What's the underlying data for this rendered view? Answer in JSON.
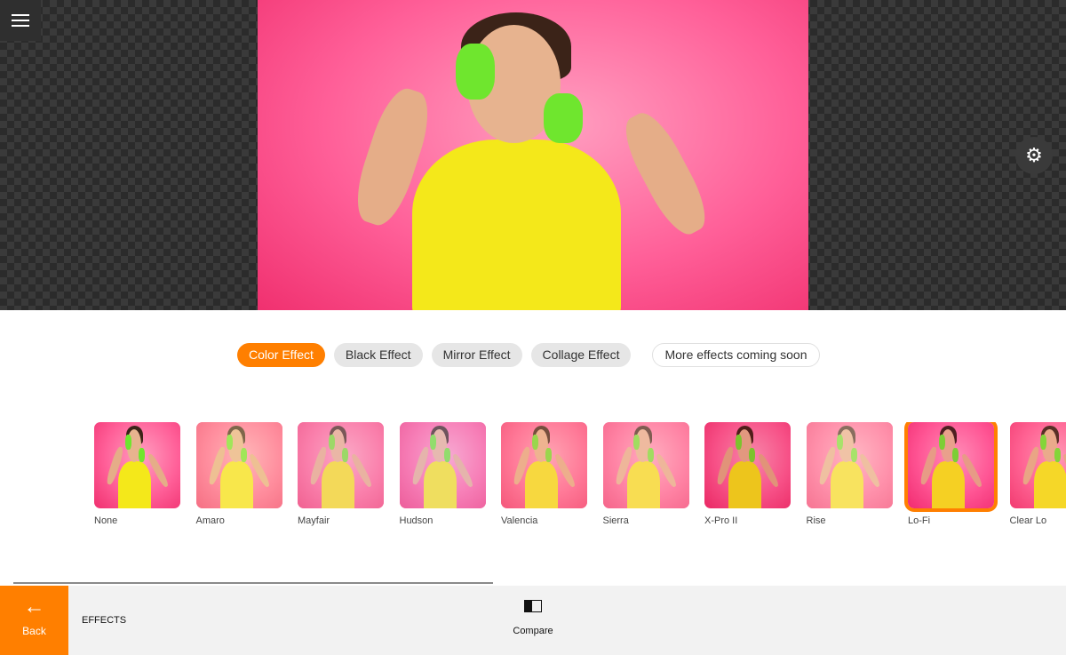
{
  "colors": {
    "accent": "#ff7f00",
    "bar": "#f2f2f2"
  },
  "toolbar": {
    "menu_icon": "hamburger-icon",
    "settings_icon": "gear-icon"
  },
  "tabs": [
    {
      "label": "Color Effect",
      "active": true
    },
    {
      "label": "Black Effect"
    },
    {
      "label": "Mirror Effect"
    },
    {
      "label": "Collage Effect"
    },
    {
      "label": "More effects coming soon"
    }
  ],
  "filters": [
    {
      "label": "None",
      "tint": "rgba(0,0,0,0)"
    },
    {
      "label": "Amaro",
      "tint": "rgba(255,230,170,0.35)"
    },
    {
      "label": "Mayfair",
      "tint": "rgba(240,190,210,0.35)"
    },
    {
      "label": "Hudson",
      "tint": "rgba(230,200,255,0.3)"
    },
    {
      "label": "Valencia",
      "tint": "rgba(255,180,150,0.3)"
    },
    {
      "label": "Sierra",
      "tint": "rgba(255,200,190,0.35)"
    },
    {
      "label": "X-Pro II",
      "tint": "rgba(200,0,40,0.15)"
    },
    {
      "label": "Rise",
      "tint": "rgba(255,220,200,0.4)"
    },
    {
      "label": "Lo-Fi",
      "tint": "rgba(255,0,120,0.1)",
      "selected": true
    },
    {
      "label": "Clear Lo",
      "tint": "rgba(255,120,120,0.15)"
    }
  ],
  "bottom": {
    "back_label": "Back",
    "section_label": "EFFECTS",
    "compare_label": "Compare"
  }
}
